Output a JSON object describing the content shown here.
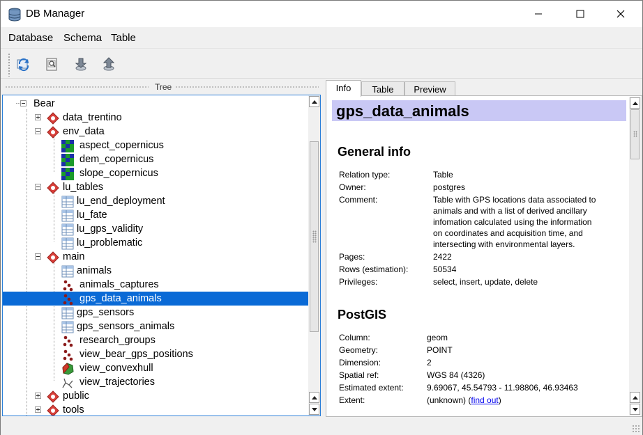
{
  "window": {
    "title": "DB Manager",
    "controls": [
      "minimize",
      "maximize",
      "close"
    ]
  },
  "menubar": {
    "items": [
      "Database",
      "Schema",
      "Table"
    ]
  },
  "toolbar": {
    "buttons": [
      "refresh-icon",
      "sql-window-icon",
      "import-layer-icon",
      "export-layer-icon"
    ]
  },
  "tree": {
    "header": "Tree",
    "root": "Bear",
    "schemas": {
      "data_trentino": "data_trentino",
      "env_data": "env_data",
      "lu_tables": "lu_tables",
      "main": "main",
      "public": "public",
      "tools": "tools"
    },
    "env_data_items": [
      "aspect_copernicus",
      "dem_copernicus",
      "slope_copernicus"
    ],
    "lu_tables_items": [
      "lu_end_deployment",
      "lu_fate",
      "lu_gps_validity",
      "lu_problematic"
    ],
    "main_items": [
      "animals",
      "animals_captures",
      "gps_data_animals",
      "gps_sensors",
      "gps_sensors_animals",
      "research_groups",
      "view_bear_gps_positions",
      "view_convexhull",
      "view_trajectories"
    ],
    "selected": "gps_data_animals"
  },
  "tabs": [
    "Info",
    "Table",
    "Preview"
  ],
  "info": {
    "title": "gps_data_animals",
    "general": {
      "heading": "General info",
      "relation_type_label": "Relation type:",
      "relation_type": "Table",
      "owner_label": "Owner:",
      "owner": "postgres",
      "comment_label": "Comment:",
      "comment_lines": [
        "Table with GPS locations data associated to",
        "animals and with a list of derived ancillary",
        "infomation calculated using the information",
        "on coordinates and acquisition time, and",
        "intersecting with environmental layers."
      ],
      "pages_label": "Pages:",
      "pages": "2422",
      "rows_label": "Rows (estimation):",
      "rows": "50534",
      "privileges_label": "Privileges:",
      "privileges": "select, insert, update, delete"
    },
    "postgis": {
      "heading": "PostGIS",
      "column_label": "Column:",
      "column": "geom",
      "geometry_label": "Geometry:",
      "geometry": "POINT",
      "dimension_label": "Dimension:",
      "dimension": "2",
      "srid_label": "Spatial ref:",
      "srid": "WGS 84 (4326)",
      "est_extent_label": "Estimated extent:",
      "est_extent": "9.69067, 45.54793 - 11.98806, 46.93463",
      "extent_label": "Extent:",
      "extent": "(unknown)",
      "find_out_link": "find out"
    }
  },
  "colors": {
    "selection": "#0a6ad6",
    "title_band": "#c9c8f5",
    "focus_border": "#2b7fd8",
    "schema_icon": "#d9403a",
    "raster_icon": "#1a9a2a",
    "point_icon": "#8b1a1a"
  }
}
